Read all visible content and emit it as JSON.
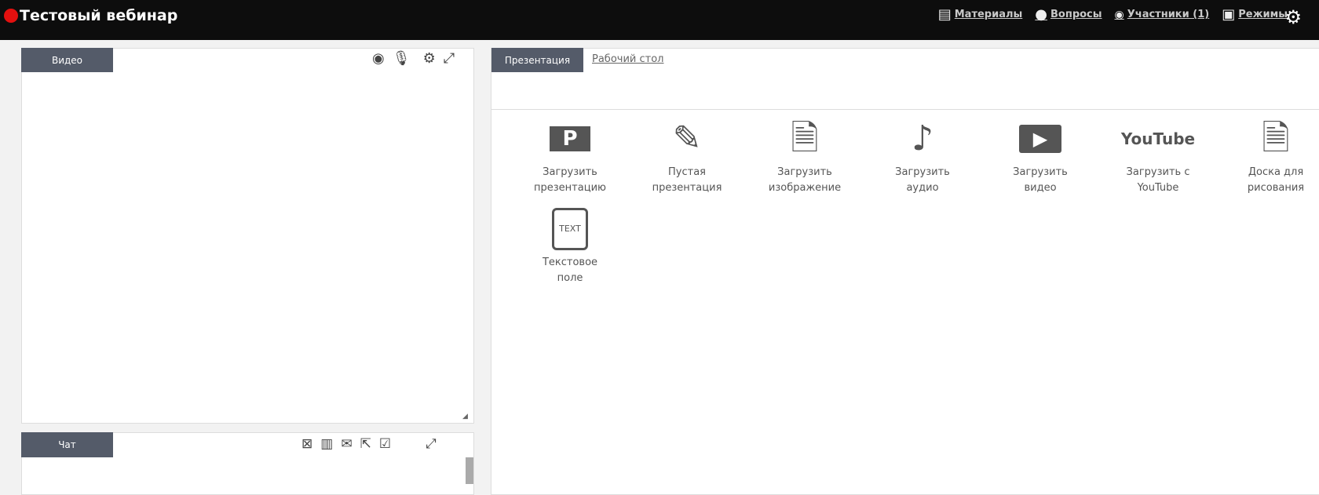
{
  "header": {
    "title": "Тестовый вебинар",
    "nav": [
      {
        "icon": "clipboard-icon",
        "label": "Материалы"
      },
      {
        "icon": "question-bubble-icon",
        "label": "Вопросы"
      },
      {
        "icon": "eye-icon",
        "label": "Участники (1)"
      },
      {
        "icon": "layout-icon",
        "label": "Режимы"
      }
    ],
    "settings_icon": "gear-icon",
    "accent": "#e3100f"
  },
  "video": {
    "tab": "Видео",
    "tools": [
      "webcam-icon",
      "microphone-icon",
      "gear-icon",
      "expand-icon"
    ]
  },
  "chat": {
    "tab": "Чат",
    "tools": [
      "clear-icon",
      "excel-icon",
      "mail-icon",
      "export-icon",
      "check-icon",
      "expand-icon"
    ]
  },
  "presentation": {
    "tabs": [
      {
        "label": "Презентация",
        "active": true
      },
      {
        "label": "Рабочий стол",
        "active": false
      }
    ],
    "items": [
      {
        "icon": "powerpoint-icon",
        "line1": "Загрузить",
        "line2": "презентацию"
      },
      {
        "icon": "pencil-icon",
        "line1": "Пустая",
        "line2": "презентация"
      },
      {
        "icon": "image-file-icon",
        "line1": "Загрузить",
        "line2": "изображение"
      },
      {
        "icon": "music-note-icon",
        "line1": "Загрузить",
        "line2": "аудио"
      },
      {
        "icon": "video-play-icon",
        "line1": "Загрузить",
        "line2": "видео"
      },
      {
        "icon": "youtube-icon",
        "line1": "Загрузить с",
        "line2": "YouTube",
        "logo": "YouTube"
      },
      {
        "icon": "image-file-icon",
        "line1": "Доска для",
        "line2": "рисования"
      },
      {
        "icon": "text-file-icon",
        "line1": "Текстовое",
        "line2": "поле",
        "logo": "TEXT"
      }
    ]
  }
}
